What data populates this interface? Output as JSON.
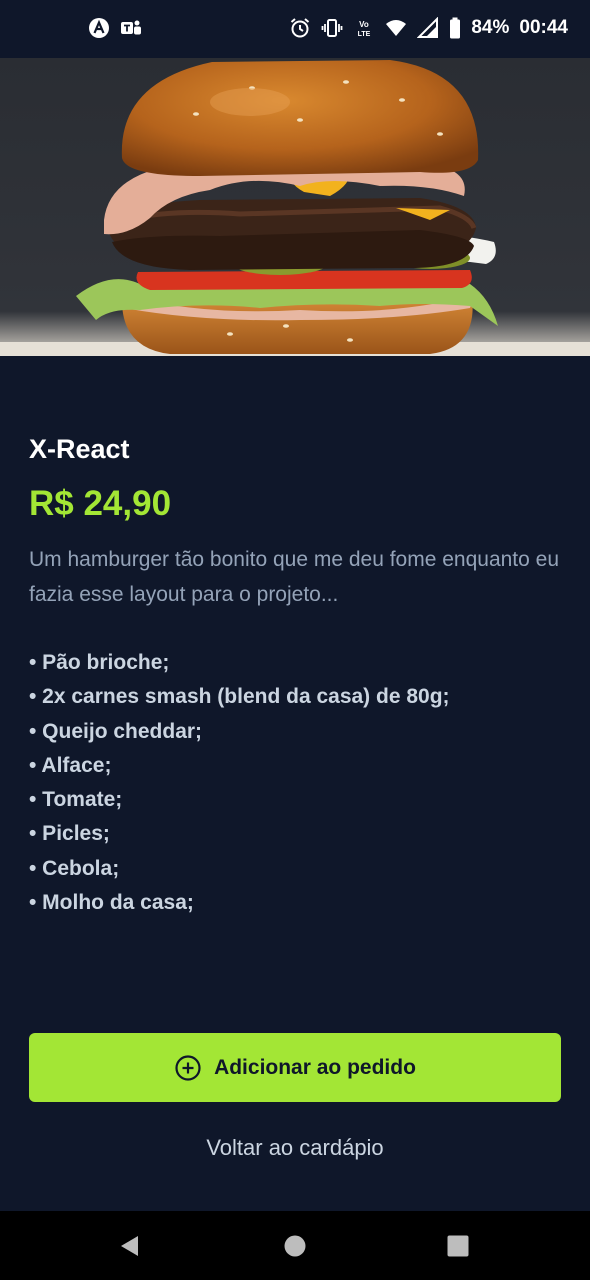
{
  "status_bar": {
    "battery": "84%",
    "time": "00:44",
    "left_icons": [
      "app-a-icon",
      "teams-icon"
    ],
    "right_icons": [
      "alarm-icon",
      "vibrate-icon",
      "volte-icon",
      "wifi-icon",
      "signal-icon",
      "battery-icon"
    ]
  },
  "product": {
    "name": "X-React",
    "price": "R$ 24,90",
    "description": "Um hamburger tão bonito que me deu fome enquanto eu fazia esse layout para o projeto...",
    "ingredients": [
      "• Pão brioche;",
      "• 2x carnes smash (blend da casa) de 80g;",
      "• Queijo cheddar;",
      "• Alface;",
      "• Tomate;",
      "• Picles;",
      "• Cebola;",
      "• Molho da casa;"
    ]
  },
  "actions": {
    "add_label": "Adicionar ao pedido",
    "back_label": "Voltar ao cardápio"
  },
  "colors": {
    "background": "#0f172a",
    "accent": "#a3e635",
    "muted_text": "#94a3b8"
  }
}
